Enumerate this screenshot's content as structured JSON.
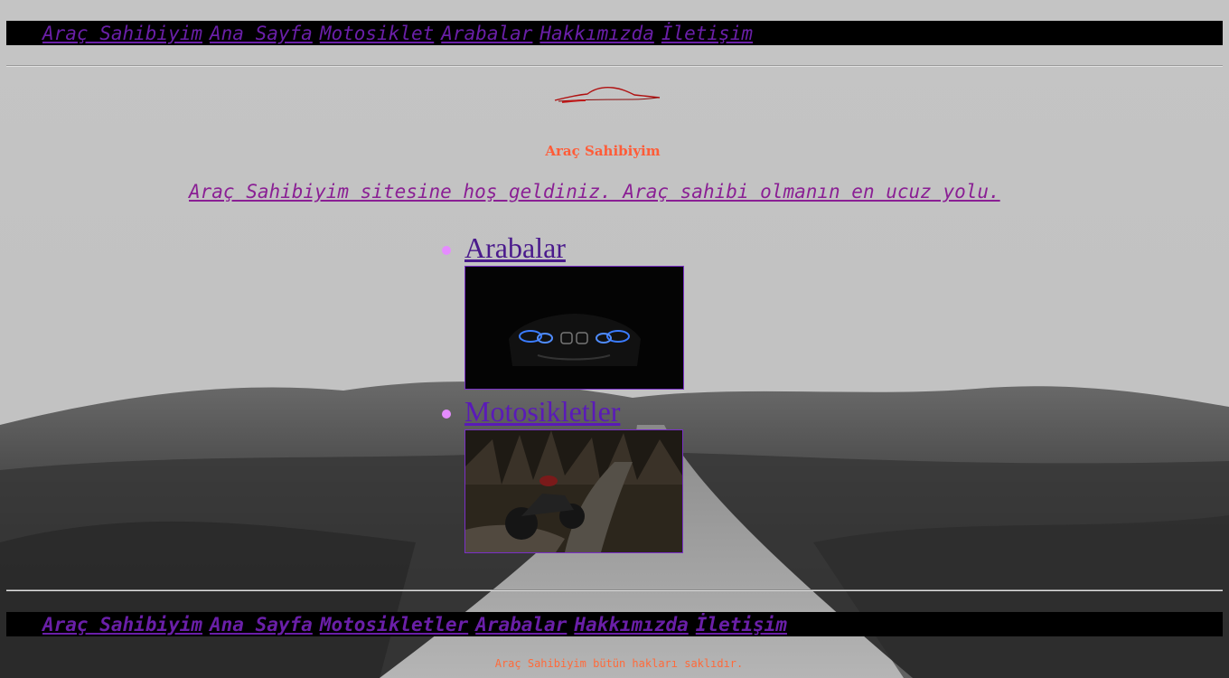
{
  "top_nav": {
    "items": [
      "Araç Sahibiyim ",
      "Ana Sayfa ",
      "Motosiklet ",
      "Arabalar ",
      "Hakkımızda ",
      "İletişim"
    ]
  },
  "site_title": "Araç Sahibiyim",
  "welcome": "Araç Sahibiyim sitesine hoş geldiniz. Araç sahibi olmanın en ucuz yolu.",
  "categories": [
    {
      "label": "Arabalar"
    },
    {
      "label": "Motosikletler"
    }
  ],
  "bottom_nav": {
    "items": [
      "Araç Sahibiyim ",
      "Ana Sayfa ",
      "Motosikletler ",
      "Arabalar ",
      "Hakkımızda ",
      "İletişim"
    ]
  },
  "footer_note": "Araç Sahibiyim bütün hakları saklıdır.",
  "colors": {
    "nav_bg": "#000000",
    "nav_link": "#6a1fa8",
    "title": "#ff5c38",
    "welcome": "#8a1f94",
    "bullet": "#e58cff",
    "category_link": "#4a1a8c"
  },
  "icons": [
    "car-logo-icon"
  ]
}
